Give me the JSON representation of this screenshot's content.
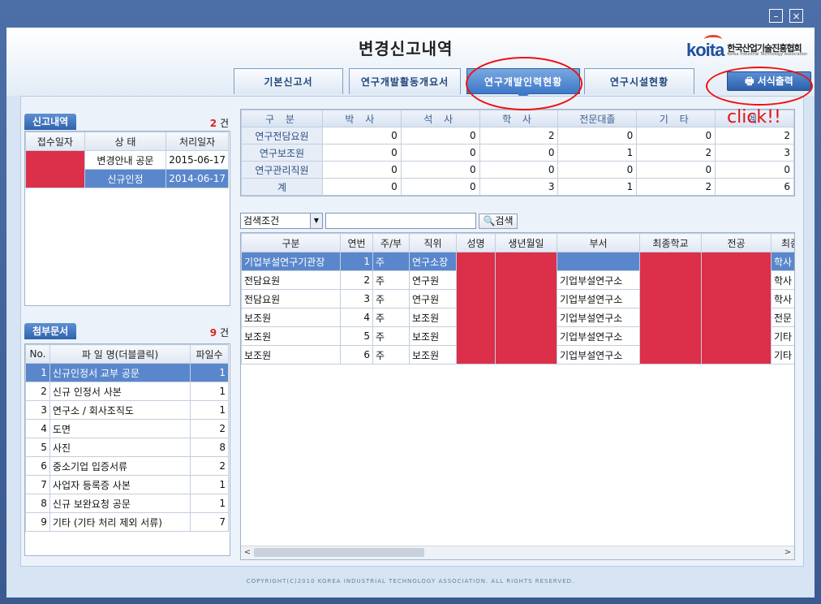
{
  "window": {
    "minimize": "–",
    "close": "×"
  },
  "page_title": "변경신고내역",
  "logo": {
    "mark": "koita",
    "kor": "한국산업기술진흥협회",
    "eng": "Korea Industrial Technology Association"
  },
  "tabs": [
    {
      "label": "기본신고서"
    },
    {
      "label": "연구개발활동개요서"
    },
    {
      "label": "연구개발인력현황"
    },
    {
      "label": "연구시설현황"
    }
  ],
  "print_button": {
    "label": "서식출력"
  },
  "annotation": {
    "text": "click!!"
  },
  "reports": {
    "title": "신고내역",
    "count": "2",
    "unit": "건",
    "headers": [
      "접수일자",
      "상 태",
      "처리일자"
    ],
    "rows": [
      {
        "date": "",
        "status": "변경안내 공문",
        "processed": "2015-06-17"
      },
      {
        "date": "",
        "status": "신규인정",
        "processed": "2014-06-17"
      }
    ]
  },
  "attachments": {
    "title": "첨부문서",
    "count": "9",
    "unit": "건",
    "headers": [
      "No.",
      "파 일 명(더블클릭)",
      "파일수"
    ],
    "rows": [
      {
        "no": "1",
        "name": "신규인정서 교부 공문",
        "files": "1"
      },
      {
        "no": "2",
        "name": "신규 인정서 사본",
        "files": "1"
      },
      {
        "no": "3",
        "name": "연구소 / 회사조직도",
        "files": "1"
      },
      {
        "no": "4",
        "name": "도면",
        "files": "2"
      },
      {
        "no": "5",
        "name": "사진",
        "files": "8"
      },
      {
        "no": "6",
        "name": "중소기업 입증서류",
        "files": "2"
      },
      {
        "no": "7",
        "name": "사업자 등록증 사본",
        "files": "1"
      },
      {
        "no": "8",
        "name": "신규 보완요청 공문",
        "files": "1"
      },
      {
        "no": "9",
        "name": "기타 (기타 처리 제외 서류)",
        "files": "7"
      }
    ]
  },
  "stats": {
    "headers": [
      "구 분",
      "박 사",
      "석 사",
      "학 사",
      "전문대졸",
      "기 타",
      "계"
    ],
    "rows": [
      {
        "label": "연구전담요원",
        "v": [
          "0",
          "0",
          "2",
          "0",
          "0",
          "2"
        ]
      },
      {
        "label": "연구보조원",
        "v": [
          "0",
          "0",
          "0",
          "1",
          "2",
          "3"
        ]
      },
      {
        "label": "연구관리직원",
        "v": [
          "0",
          "0",
          "0",
          "0",
          "0",
          "0"
        ]
      },
      {
        "label": "계",
        "v": [
          "0",
          "0",
          "3",
          "1",
          "2",
          "6"
        ]
      }
    ]
  },
  "search": {
    "condition": "검색조건",
    "button": "검색",
    "value": ""
  },
  "staff": {
    "headers": [
      "구분",
      "연번",
      "주/부",
      "직위",
      "성명",
      "생년월일",
      "부서",
      "최종학교",
      "전공",
      "최종"
    ],
    "rows": [
      {
        "type": "기업부설연구기관장",
        "seq": "1",
        "main": "주",
        "pos": "연구소장",
        "dept": "",
        "edu": "학사"
      },
      {
        "type": "전담요원",
        "seq": "2",
        "main": "주",
        "pos": "연구원",
        "dept": "기업부설연구소",
        "edu": "학사"
      },
      {
        "type": "전담요원",
        "seq": "3",
        "main": "주",
        "pos": "연구원",
        "dept": "기업부설연구소",
        "edu": "학사"
      },
      {
        "type": "보조원",
        "seq": "4",
        "main": "주",
        "pos": "보조원",
        "dept": "기업부설연구소",
        "edu": "전문"
      },
      {
        "type": "보조원",
        "seq": "5",
        "main": "주",
        "pos": "보조원",
        "dept": "기업부설연구소",
        "edu": "기타"
      },
      {
        "type": "보조원",
        "seq": "6",
        "main": "주",
        "pos": "보조원",
        "dept": "기업부설연구소",
        "edu": "기타"
      }
    ]
  },
  "footer": "COPYRIGHT(C)2010 KOREA INDUSTRIAL TECHNOLOGY ASSOCIATION. ALL RIGHTS RESERVED.",
  "colors": {
    "accent": "#3e78c8",
    "redacted": "#dc2f4a",
    "annotation": "#ee1111"
  }
}
